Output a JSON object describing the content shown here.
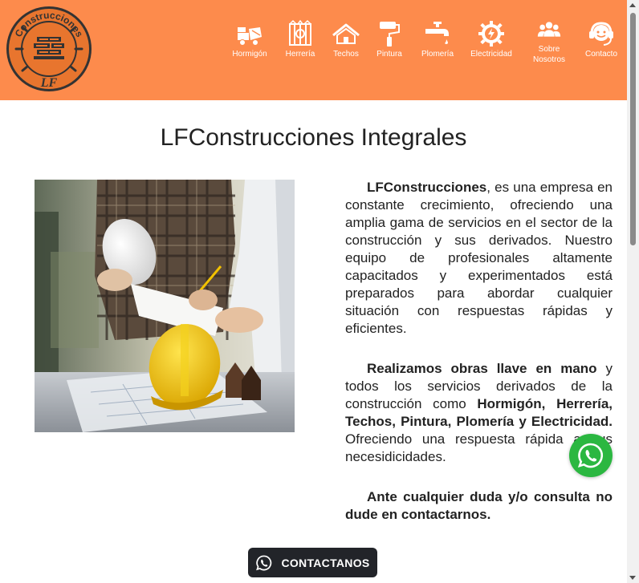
{
  "header": {
    "brand_color": "#fd8b4c",
    "logo": {
      "top_text": "Construcciones",
      "bottom_text": "LF"
    },
    "nav": [
      {
        "label": "Hormigón",
        "icon": "concrete-mixer-icon"
      },
      {
        "label": "Herrería",
        "icon": "iron-gate-icon"
      },
      {
        "label": "Techos",
        "icon": "roof-icon"
      },
      {
        "label": "Pintura",
        "icon": "paint-roller-icon"
      },
      {
        "label": "Plomería",
        "icon": "faucet-icon"
      },
      {
        "label": "Electricidad",
        "icon": "electricity-gear-icon"
      },
      {
        "label": "Sobre Nosotros",
        "icon": "team-icon"
      },
      {
        "label": "Contacto",
        "icon": "support-headset-icon"
      }
    ]
  },
  "main": {
    "title": "LFConstrucciones Integrales",
    "photo": {
      "icon": "construction-workers-photo"
    },
    "paragraph1": {
      "lead": "LFConstrucciones",
      "text": ", es una empresa en constante crecimiento, ofreciendo una amplia gama de servicios en el sector de la construcción y sus derivados. Nuestro equipo de profesionales altamente capacitados y experimentados está preparados para abordar cualquier situación con respuestas rápidas y eficientes."
    },
    "paragraph2": {
      "lead": "Realizamos obras llave en mano",
      "text1": " y todos los servicios derivados de la construcción como ",
      "services": "Hormigón, Herrería, Techos, Pintura, Plomería y Electricidad.",
      "text2": " Ofreciendo una respuesta rápida a sus necesidicidades."
    },
    "paragraph3": {
      "text": "Ante cualquier duda y/o consulta no dude en contactarnos."
    }
  },
  "whatsapp_float": {
    "icon": "whatsapp-icon",
    "color": "#2bb741"
  },
  "contact_button": {
    "label": "CONTACTANOS",
    "icon": "whatsapp-icon"
  }
}
